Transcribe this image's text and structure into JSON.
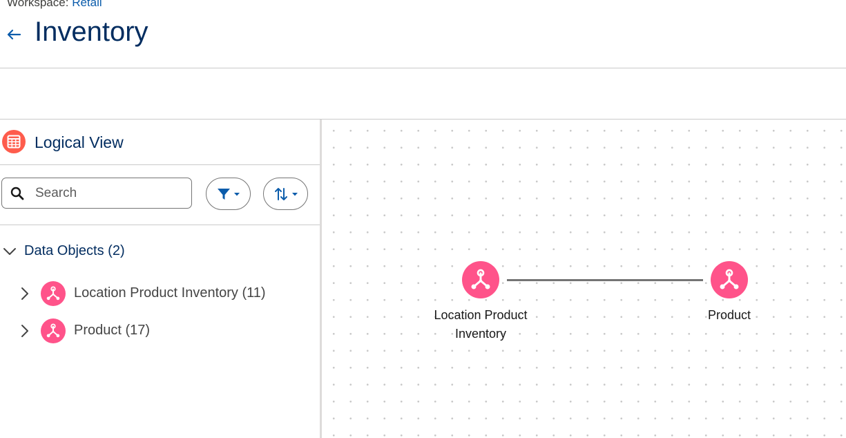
{
  "header": {
    "workspace_prefix": "Workspace:",
    "workspace_name": "Retail",
    "title": "Inventory"
  },
  "left_panel": {
    "title": "Logical View",
    "search": {
      "placeholder": "Search",
      "value": ""
    },
    "section": {
      "label": "Data Objects (2)"
    },
    "items": [
      {
        "label": "Location Product Inventory (11)"
      },
      {
        "label": "Product (17)"
      }
    ]
  },
  "canvas": {
    "nodes": [
      {
        "label": "Location Product Inventory"
      },
      {
        "label": "Product"
      }
    ]
  },
  "colors": {
    "accent": "#0b5cab",
    "title": "#032d60",
    "logical_view_icon": "#fe5c4c",
    "data_object_icon": "#ff538a",
    "edge": "#747474"
  },
  "icons": {
    "back": "back-arrow-icon",
    "logical_view": "table-grid-icon",
    "search": "search-icon",
    "filter": "filter-icon",
    "sort": "sort-icon",
    "data_object": "data-object-icon"
  }
}
